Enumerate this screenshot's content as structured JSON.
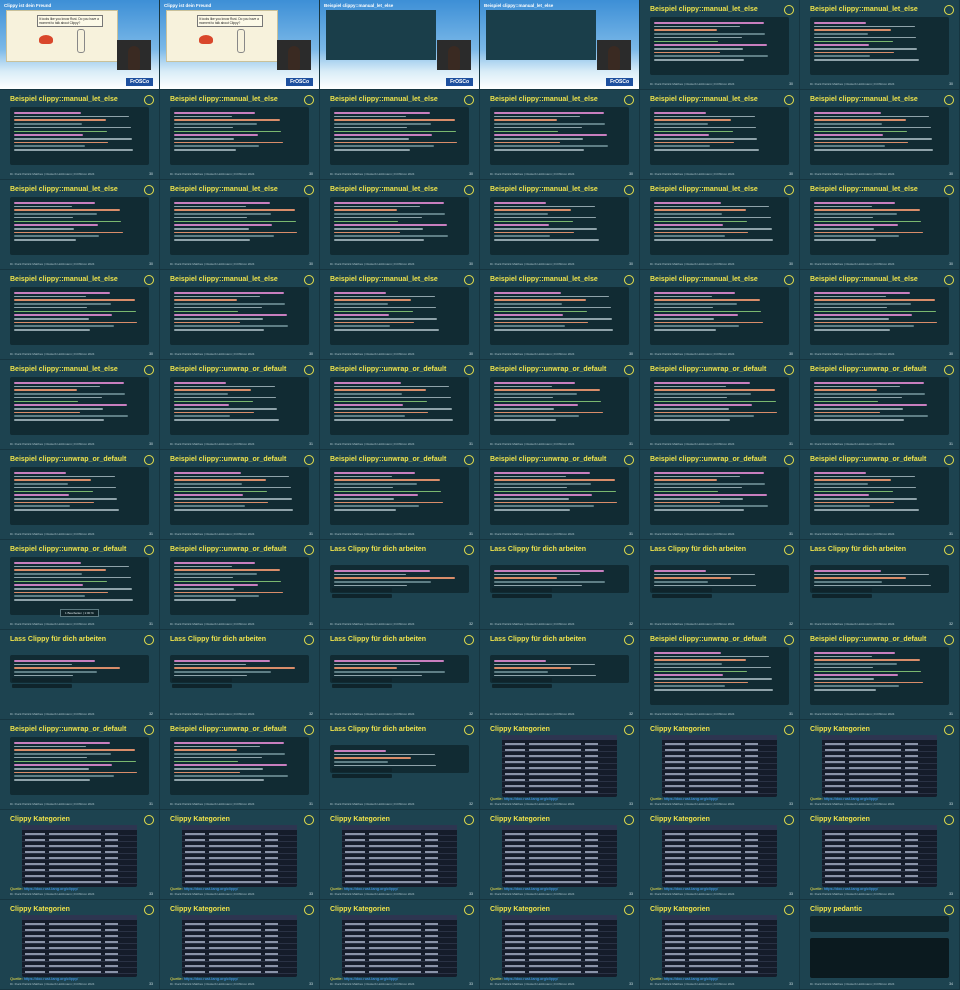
{
  "colors": {
    "background": "#1b3d48",
    "title_yellow": "#f0e44a",
    "code_bg": "#112b33",
    "table_bg": "#151c2a",
    "frosc_blue": "#1d4f9e"
  },
  "footer_text": "Dr. Ruck Patrick Matthes | Clusterb Holtzmann | FrOSCon 2024",
  "frosc_label": "FrOSCo",
  "bubble_text": "It looks like you know Rust. Do you have a moment to talk about Clippy?",
  "quelle": {
    "label": "Quelle:",
    "link": "https://doc.rust-lang.org/clippy/"
  },
  "tooltip_text": "1 Bearbeiten | 1:00 %",
  "slides": [
    {
      "kind": "video",
      "title": "Clippy ist dein Freund",
      "variant": "cartoon"
    },
    {
      "kind": "video",
      "title": "Clippy ist dein Freund",
      "variant": "cartoon"
    },
    {
      "kind": "video",
      "title": "Beispiel clippy::manual_let_else",
      "variant": "code"
    },
    {
      "kind": "video",
      "title": "Beispiel clippy::manual_let_else",
      "variant": "code"
    },
    {
      "kind": "code",
      "title": "Beispiel clippy::manual_let_else",
      "page": "30"
    },
    {
      "kind": "code",
      "title": "Beispiel clippy::manual_let_else",
      "page": "30"
    },
    {
      "kind": "code",
      "title": "Beispiel clippy::manual_let_else",
      "page": "30"
    },
    {
      "kind": "code",
      "title": "Beispiel clippy::manual_let_else",
      "page": "30"
    },
    {
      "kind": "code",
      "title": "Beispiel clippy::manual_let_else",
      "page": "30"
    },
    {
      "kind": "code",
      "title": "Beispiel clippy::manual_let_else",
      "page": "30"
    },
    {
      "kind": "code",
      "title": "Beispiel clippy::manual_let_else",
      "page": "30"
    },
    {
      "kind": "code",
      "title": "Beispiel clippy::manual_let_else",
      "page": "30"
    },
    {
      "kind": "code",
      "title": "Beispiel clippy::manual_let_else",
      "page": "30"
    },
    {
      "kind": "code",
      "title": "Beispiel clippy::manual_let_else",
      "page": "30"
    },
    {
      "kind": "code",
      "title": "Beispiel clippy::manual_let_else",
      "page": "30"
    },
    {
      "kind": "code",
      "title": "Beispiel clippy::manual_let_else",
      "page": "30"
    },
    {
      "kind": "code",
      "title": "Beispiel clippy::manual_let_else",
      "page": "30"
    },
    {
      "kind": "code",
      "title": "Beispiel clippy::manual_let_else",
      "page": "30"
    },
    {
      "kind": "code",
      "title": "Beispiel clippy::manual_let_else",
      "page": "30"
    },
    {
      "kind": "code",
      "title": "Beispiel clippy::manual_let_else",
      "page": "30"
    },
    {
      "kind": "code",
      "title": "Beispiel clippy::manual_let_else",
      "page": "30"
    },
    {
      "kind": "code",
      "title": "Beispiel clippy::manual_let_else",
      "page": "30"
    },
    {
      "kind": "code",
      "title": "Beispiel clippy::manual_let_else",
      "page": "30"
    },
    {
      "kind": "code",
      "title": "Beispiel clippy::manual_let_else",
      "page": "30"
    },
    {
      "kind": "code",
      "title": "Beispiel clippy::manual_let_else",
      "page": "30"
    },
    {
      "kind": "code",
      "title": "Beispiel clippy::unwrap_or_default",
      "page": "31"
    },
    {
      "kind": "code",
      "title": "Beispiel clippy::unwrap_or_default",
      "page": "31"
    },
    {
      "kind": "code",
      "title": "Beispiel clippy::unwrap_or_default",
      "page": "31"
    },
    {
      "kind": "code",
      "title": "Beispiel clippy::unwrap_or_default",
      "page": "31"
    },
    {
      "kind": "code",
      "title": "Beispiel clippy::unwrap_or_default",
      "page": "31"
    },
    {
      "kind": "code",
      "title": "Beispiel clippy::unwrap_or_default",
      "page": "31"
    },
    {
      "kind": "code",
      "title": "Beispiel clippy::unwrap_or_default",
      "page": "31"
    },
    {
      "kind": "code",
      "title": "Beispiel clippy::unwrap_or_default",
      "page": "31"
    },
    {
      "kind": "code",
      "title": "Beispiel clippy::unwrap_or_default",
      "page": "31"
    },
    {
      "kind": "code",
      "title": "Beispiel clippy::unwrap_or_default",
      "page": "31"
    },
    {
      "kind": "code",
      "title": "Beispiel clippy::unwrap_or_default",
      "page": "31"
    },
    {
      "kind": "code",
      "title": "Beispiel clippy::unwrap_or_default",
      "page": "31",
      "tooltip": true
    },
    {
      "kind": "code",
      "title": "Beispiel clippy::unwrap_or_default",
      "page": "31"
    },
    {
      "kind": "lass",
      "title": "Lass Clippy für dich arbeiten",
      "page": "32"
    },
    {
      "kind": "lass",
      "title": "Lass Clippy für dich arbeiten",
      "page": "32"
    },
    {
      "kind": "lass",
      "title": "Lass Clippy für dich arbeiten",
      "page": "32"
    },
    {
      "kind": "lass",
      "title": "Lass Clippy für dich arbeiten",
      "page": "32"
    },
    {
      "kind": "lass",
      "title": "Lass Clippy für dich arbeiten",
      "page": "32"
    },
    {
      "kind": "lass",
      "title": "Lass Clippy für dich arbeiten",
      "page": "32"
    },
    {
      "kind": "lass",
      "title": "Lass Clippy für dich arbeiten",
      "page": "32"
    },
    {
      "kind": "lass",
      "title": "Lass Clippy für dich arbeiten",
      "page": "32"
    },
    {
      "kind": "code",
      "title": "Beispiel clippy::unwrap_or_default",
      "page": "31"
    },
    {
      "kind": "code",
      "title": "Beispiel clippy::unwrap_or_default",
      "page": "31"
    },
    {
      "kind": "code",
      "title": "Beispiel clippy::unwrap_or_default",
      "page": "31"
    },
    {
      "kind": "code",
      "title": "Beispiel clippy::unwrap_or_default",
      "page": "31"
    },
    {
      "kind": "lass",
      "title": "Lass Clippy für dich arbeiten",
      "page": "32"
    },
    {
      "kind": "table",
      "title": "Clippy Kategorien",
      "page": "33"
    },
    {
      "kind": "table",
      "title": "Clippy Kategorien",
      "page": "33"
    },
    {
      "kind": "table",
      "title": "Clippy Kategorien",
      "page": "33"
    },
    {
      "kind": "table",
      "title": "Clippy Kategorien",
      "page": "33"
    },
    {
      "kind": "table",
      "title": "Clippy Kategorien",
      "page": "33"
    },
    {
      "kind": "table",
      "title": "Clippy Kategorien",
      "page": "33"
    },
    {
      "kind": "table",
      "title": "Clippy Kategorien",
      "page": "33"
    },
    {
      "kind": "table",
      "title": "Clippy Kategorien",
      "page": "33"
    },
    {
      "kind": "table",
      "title": "Clippy Kategorien",
      "page": "33"
    },
    {
      "kind": "table",
      "title": "Clippy Kategorien",
      "page": "33"
    },
    {
      "kind": "table",
      "title": "Clippy Kategorien",
      "page": "33"
    },
    {
      "kind": "table",
      "title": "Clippy Kategorien",
      "page": "33"
    },
    {
      "kind": "table",
      "title": "Clippy Kategorien",
      "page": "33"
    },
    {
      "kind": "table",
      "title": "Clippy Kategorien",
      "page": "33"
    },
    {
      "kind": "pedantic",
      "title": "Clippy pedantic",
      "page": "34"
    }
  ]
}
